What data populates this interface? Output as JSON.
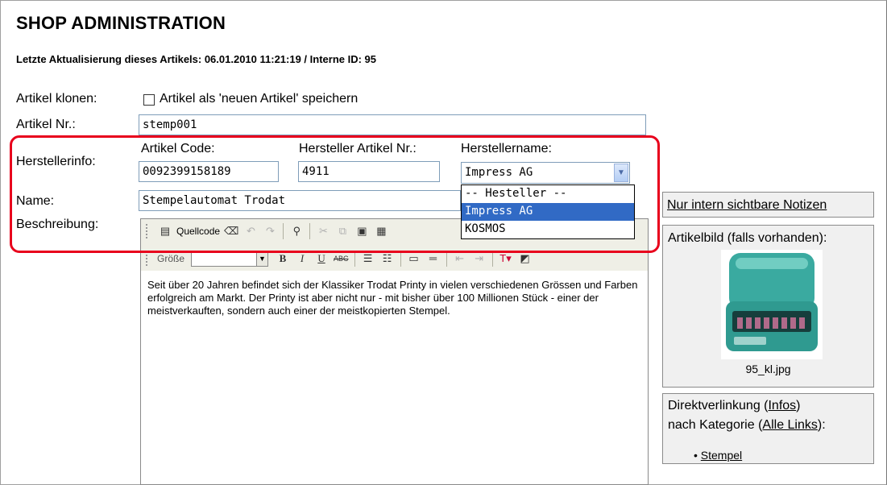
{
  "header": {
    "title": "SHOP ADMINISTRATION",
    "update_line": "Letzte Aktualisierung dieses Artikels: 06.01.2010 11:21:19 / Interne ID: 95"
  },
  "form": {
    "clone_label": "Artikel klonen:",
    "clone_checkbox_label": "Artikel als 'neuen Artikel' speichern",
    "article_no_label": "Artikel Nr.:",
    "article_no_value": "stemp001",
    "manufacturer_info_label": "Herstellerinfo:",
    "article_code_label": "Artikel Code:",
    "article_code_value": "0092399158189",
    "manufacturer_article_no_label": "Hersteller Artikel Nr.:",
    "manufacturer_article_no_value": "4911",
    "manufacturer_name_label": "Herstellername:",
    "manufacturer_name_selected": "Impress AG",
    "manufacturer_options": [
      "-- Hesteller --",
      "Impress AG",
      "KOSMOS"
    ],
    "name_label": "Name:",
    "name_value": "Stempelautomat Trodat",
    "description_label": "Beschreibung:"
  },
  "editor": {
    "source_label": "Quellcode",
    "size_label": "Größe",
    "content": "Seit über 20 Jahren befindet sich der Klassiker Trodat Printy in vielen verschiedenen Grössen und Farben erfolgreich am Markt. Der Printy ist aber nicht nur - mit bisher über 100 Millionen Stück - einer der meistverkauften, sondern auch einer der meistkopierten Stempel."
  },
  "sidebar": {
    "notes_link": "Nur intern sichtbare Notizen",
    "image_title": "Artikelbild (falls vorhanden):",
    "image_filename": "95_kl.jpg",
    "direct_link_prefix": "Direktverlinkung (",
    "infos_link": "Infos",
    "direct_link_suffix": ")",
    "category_prefix": "nach Kategorie (",
    "all_links": "Alle Links",
    "category_suffix": "):",
    "category_items": [
      "Stempel"
    ]
  },
  "colors": {
    "highlight": "#e8001c",
    "selection": "#316ac5",
    "input_border": "#7f9db9"
  }
}
